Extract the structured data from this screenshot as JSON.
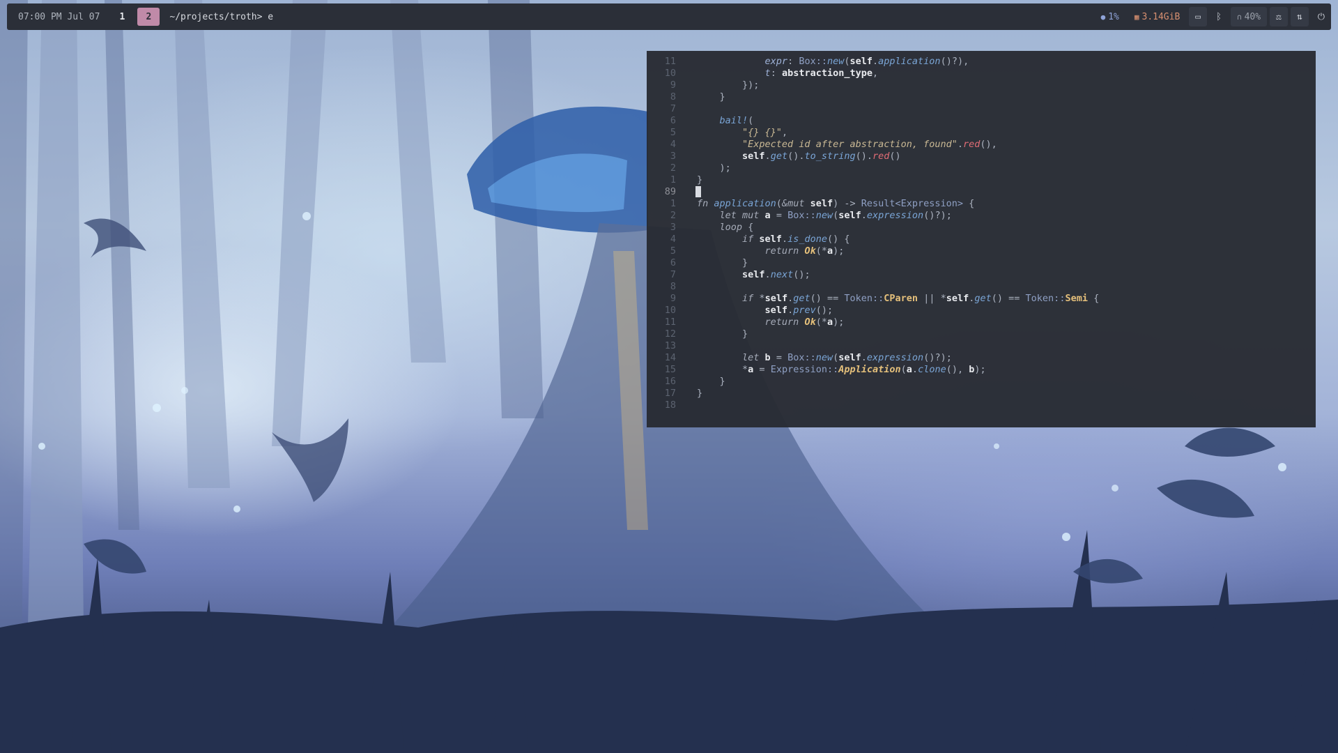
{
  "topbar": {
    "clock": "07:00 PM Jul 07",
    "workspaces": [
      "1",
      "2"
    ],
    "active_workspace": "2",
    "window_title": "~/projects/troth> e",
    "cpu": "1%",
    "memory": "3.14GiB",
    "volume": "40%",
    "icons": [
      "cpu-icon",
      "memory-icon",
      "display-icon",
      "bluetooth-icon",
      "headphones-icon",
      "balance-icon",
      "network-icon",
      "power-icon"
    ]
  },
  "editor": {
    "lines": [
      {
        "n": "11",
        "tokens": [
          [
            "",
            "            "
          ],
          [
            "field",
            "expr"
          ],
          [
            "",
            ": "
          ],
          [
            "ty",
            "Box::"
          ],
          [
            "fn",
            "new"
          ],
          [
            "",
            "("
          ],
          [
            "self",
            "self"
          ],
          [
            "",
            "."
          ],
          [
            "fn",
            "application"
          ],
          [
            "",
            "()?),"
          ]
        ]
      },
      {
        "n": "10",
        "tokens": [
          [
            "",
            "            "
          ],
          [
            "field",
            "t"
          ],
          [
            "",
            ": "
          ],
          [
            "var",
            "abstraction_type"
          ],
          [
            "",
            ","
          ]
        ]
      },
      {
        "n": "9",
        "tokens": [
          [
            "",
            "        });"
          ]
        ]
      },
      {
        "n": "8",
        "tokens": [
          [
            "",
            "    }"
          ]
        ]
      },
      {
        "n": "7",
        "tokens": []
      },
      {
        "n": "6",
        "tokens": [
          [
            "",
            "    "
          ],
          [
            "fn",
            "bail!"
          ],
          [
            "",
            "("
          ]
        ]
      },
      {
        "n": "5",
        "tokens": [
          [
            "",
            "        "
          ],
          [
            "str",
            "\"{} {}\""
          ],
          [
            "",
            ","
          ]
        ]
      },
      {
        "n": "4",
        "tokens": [
          [
            "",
            "        "
          ],
          [
            "str",
            "\"Expected id after abstraction, found\""
          ],
          [
            "",
            "."
          ],
          [
            "red",
            "red"
          ],
          [
            "",
            "(),"
          ]
        ]
      },
      {
        "n": "3",
        "tokens": [
          [
            "",
            "        "
          ],
          [
            "self",
            "self"
          ],
          [
            "",
            "."
          ],
          [
            "fn",
            "get"
          ],
          [
            "",
            "()."
          ],
          [
            "fn",
            "to_string"
          ],
          [
            "",
            "()."
          ],
          [
            "red",
            "red"
          ],
          [
            "",
            "()"
          ]
        ]
      },
      {
        "n": "2",
        "tokens": [
          [
            "",
            "    );"
          ]
        ]
      },
      {
        "n": "1",
        "tokens": [
          [
            "",
            "}"
          ]
        ]
      },
      {
        "n": "89",
        "tokens": [],
        "cursor": true
      },
      {
        "n": "1",
        "tokens": [
          [
            "kw",
            "fn "
          ],
          [
            "fn",
            "application"
          ],
          [
            "",
            "("
          ],
          [
            "kw",
            "&mut "
          ],
          [
            "self",
            "self"
          ],
          [
            "",
            ") -> "
          ],
          [
            "ty",
            "Result<Expression>"
          ],
          [
            "",
            " {"
          ]
        ]
      },
      {
        "n": "2",
        "tokens": [
          [
            "",
            "    "
          ],
          [
            "kw",
            "let mut "
          ],
          [
            "var",
            "a"
          ],
          [
            "",
            " = "
          ],
          [
            "ty",
            "Box::"
          ],
          [
            "fn",
            "new"
          ],
          [
            "",
            "("
          ],
          [
            "self",
            "self"
          ],
          [
            "",
            "."
          ],
          [
            "fn",
            "expression"
          ],
          [
            "",
            "()?);"
          ]
        ]
      },
      {
        "n": "3",
        "tokens": [
          [
            "",
            "    "
          ],
          [
            "kw",
            "loop"
          ],
          [
            "",
            " {"
          ]
        ]
      },
      {
        "n": "4",
        "tokens": [
          [
            "",
            "        "
          ],
          [
            "kw",
            "if "
          ],
          [
            "self",
            "self"
          ],
          [
            "",
            "."
          ],
          [
            "fn",
            "is_done"
          ],
          [
            "",
            "() {"
          ]
        ]
      },
      {
        "n": "5",
        "tokens": [
          [
            "",
            "            "
          ],
          [
            "kw",
            "return "
          ],
          [
            "ok",
            "Ok"
          ],
          [
            "",
            "(*"
          ],
          [
            "var",
            "a"
          ],
          [
            "",
            ");"
          ]
        ]
      },
      {
        "n": "6",
        "tokens": [
          [
            "",
            "        }"
          ]
        ]
      },
      {
        "n": "7",
        "tokens": [
          [
            "",
            "        "
          ],
          [
            "self",
            "self"
          ],
          [
            "",
            "."
          ],
          [
            "fn",
            "next"
          ],
          [
            "",
            "();"
          ]
        ]
      },
      {
        "n": "8",
        "tokens": []
      },
      {
        "n": "9",
        "tokens": [
          [
            "",
            "        "
          ],
          [
            "kw",
            "if "
          ],
          [
            "",
            "*"
          ],
          [
            "self",
            "self"
          ],
          [
            "",
            "."
          ],
          [
            "fn",
            "get"
          ],
          [
            "",
            "() == "
          ],
          [
            "ty",
            "Token::"
          ],
          [
            "const",
            "CParen"
          ],
          [
            "",
            " || *"
          ],
          [
            "self",
            "self"
          ],
          [
            "",
            "."
          ],
          [
            "fn",
            "get"
          ],
          [
            "",
            "() == "
          ],
          [
            "ty",
            "Token::"
          ],
          [
            "const",
            "Semi"
          ],
          [
            "",
            " {"
          ]
        ]
      },
      {
        "n": "10",
        "tokens": [
          [
            "",
            "            "
          ],
          [
            "self",
            "self"
          ],
          [
            "",
            "."
          ],
          [
            "fn",
            "prev"
          ],
          [
            "",
            "();"
          ]
        ]
      },
      {
        "n": "11",
        "tokens": [
          [
            "",
            "            "
          ],
          [
            "kw",
            "return "
          ],
          [
            "ok",
            "Ok"
          ],
          [
            "",
            "(*"
          ],
          [
            "var",
            "a"
          ],
          [
            "",
            ");"
          ]
        ]
      },
      {
        "n": "12",
        "tokens": [
          [
            "",
            "        }"
          ]
        ]
      },
      {
        "n": "13",
        "tokens": []
      },
      {
        "n": "14",
        "tokens": [
          [
            "",
            "        "
          ],
          [
            "kw",
            "let "
          ],
          [
            "var",
            "b"
          ],
          [
            "",
            " = "
          ],
          [
            "ty",
            "Box::"
          ],
          [
            "fn",
            "new"
          ],
          [
            "",
            "("
          ],
          [
            "self",
            "self"
          ],
          [
            "",
            "."
          ],
          [
            "fn",
            "expression"
          ],
          [
            "",
            "()?);"
          ]
        ]
      },
      {
        "n": "15",
        "tokens": [
          [
            "",
            "        *"
          ],
          [
            "var",
            "a"
          ],
          [
            "",
            " = "
          ],
          [
            "ty",
            "Expression::"
          ],
          [
            "ok",
            "Application"
          ],
          [
            "",
            "("
          ],
          [
            "var",
            "a"
          ],
          [
            "",
            "."
          ],
          [
            "fn",
            "clone"
          ],
          [
            "",
            "(), "
          ],
          [
            "var",
            "b"
          ],
          [
            "",
            ");"
          ]
        ]
      },
      {
        "n": "16",
        "tokens": [
          [
            "",
            "    }"
          ]
        ]
      },
      {
        "n": "17",
        "tokens": [
          [
            "",
            "}"
          ]
        ]
      },
      {
        "n": "18",
        "tokens": []
      }
    ]
  }
}
